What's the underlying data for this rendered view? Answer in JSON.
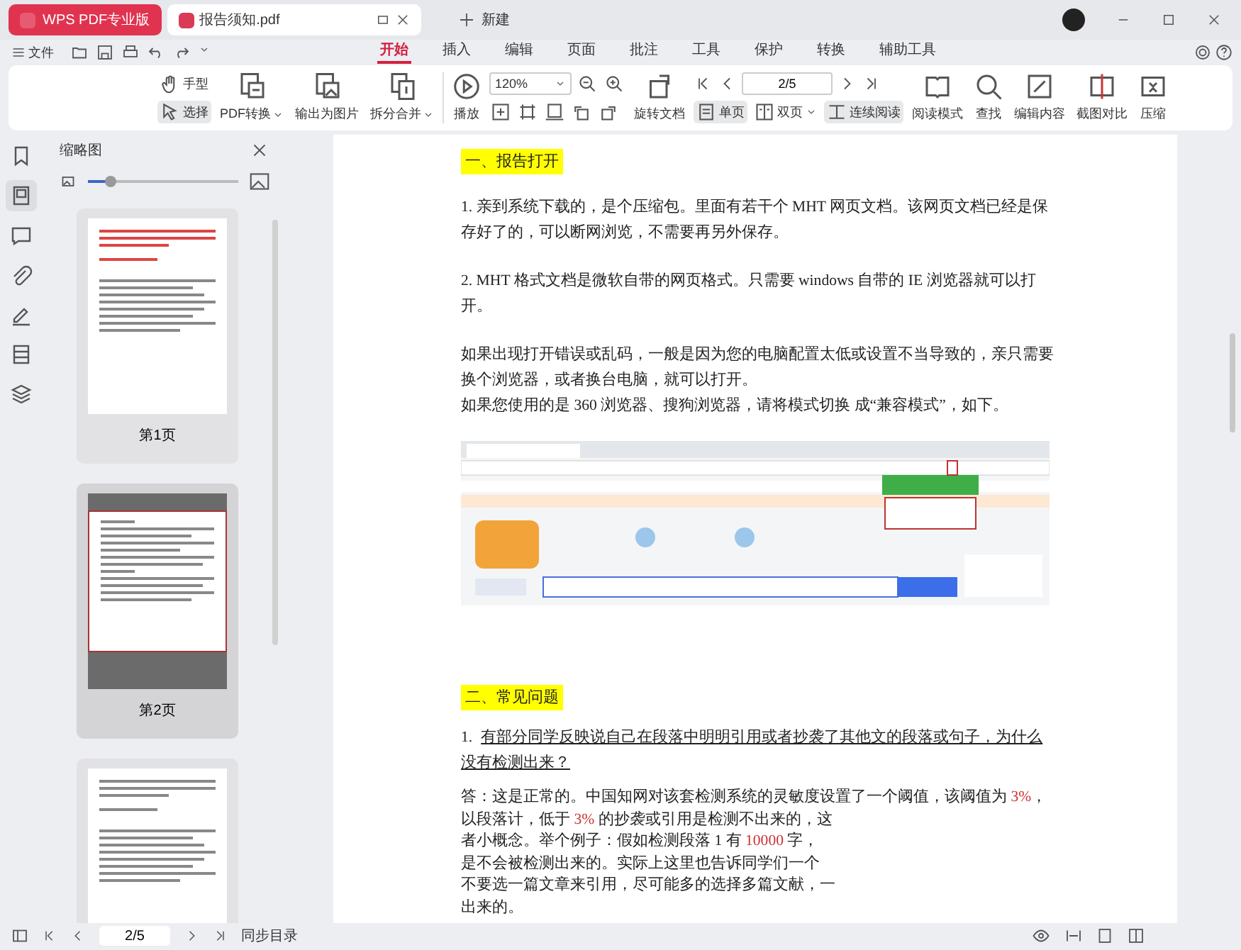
{
  "window": {
    "tabs": [
      {
        "label": "WPS PDF专业版",
        "kind": "brand",
        "selected": false
      },
      {
        "label": "报告须知.pdf",
        "kind": "file",
        "selected": true
      }
    ],
    "new_tab": "新建"
  },
  "menu": {
    "file": "文件",
    "items": [
      {
        "label": "开始",
        "selected": true
      },
      {
        "label": "插入",
        "selected": false
      },
      {
        "label": "编辑",
        "selected": false
      },
      {
        "label": "页面",
        "selected": false
      },
      {
        "label": "批注",
        "selected": false
      },
      {
        "label": "工具",
        "selected": false
      },
      {
        "label": "保护",
        "selected": false
      },
      {
        "label": "转换",
        "selected": false
      },
      {
        "label": "辅助工具",
        "selected": false
      }
    ]
  },
  "ribbon": [
    {
      "kind": "stack",
      "upper": [
        {
          "kind": "tool",
          "label": "手型",
          "selected": false
        }
      ],
      "lower": [
        {
          "kind": "tool",
          "label": "选择",
          "selected": true
        }
      ]
    },
    {
      "kind": "big",
      "label": "PDF转换",
      "dropdown": true
    },
    {
      "kind": "big",
      "label": "输出为图片"
    },
    {
      "kind": "big",
      "label": "拆分合并",
      "dropdown": true
    },
    {
      "kind": "sep"
    },
    {
      "kind": "big",
      "label": "播放"
    },
    {
      "kind": "stack",
      "upper": [
        {
          "kind": "combo",
          "value": "120%"
        },
        {
          "kind": "icon"
        },
        {
          "kind": "icon"
        }
      ],
      "lower": [
        {
          "kind": "icon"
        },
        {
          "kind": "icon"
        },
        {
          "kind": "icon"
        },
        {
          "kind": "icon"
        },
        {
          "kind": "icon"
        }
      ]
    },
    {
      "kind": "big",
      "label": "旋转文档"
    },
    {
      "kind": "stack",
      "upper": [
        {
          "kind": "icon"
        },
        {
          "kind": "icon"
        },
        {
          "kind": "pager",
          "value": "2/5"
        },
        {
          "kind": "icon"
        },
        {
          "kind": "icon"
        }
      ],
      "lower": [
        {
          "kind": "tool",
          "label": "单页",
          "selected": true
        },
        {
          "kind": "tool",
          "label": "双页",
          "selected": false,
          "dropdown": true
        },
        {
          "kind": "tool",
          "label": "连续阅读",
          "selected": true
        }
      ]
    },
    {
      "kind": "big",
      "label": "阅读模式"
    },
    {
      "kind": "big",
      "label": "查找"
    },
    {
      "kind": "big",
      "label": "编辑内容"
    },
    {
      "kind": "big",
      "label": "截图对比"
    },
    {
      "kind": "big",
      "label": "压缩"
    }
  ],
  "sidebar": {
    "items": [
      {
        "kind": "bookmark",
        "selected": false
      },
      {
        "kind": "thumbnails",
        "selected": true
      },
      {
        "kind": "comment",
        "selected": false
      },
      {
        "kind": "attachment",
        "selected": false
      },
      {
        "kind": "signature",
        "selected": false
      },
      {
        "kind": "layout",
        "selected": false
      },
      {
        "kind": "layers",
        "selected": false
      }
    ]
  },
  "thumbnails": {
    "title": "缩略图",
    "size": {
      "level": 0.15
    },
    "pages": [
      {
        "label": "第1页",
        "selected": false
      },
      {
        "label": "第2页",
        "selected": true
      },
      {
        "selected": false
      }
    ]
  },
  "document": {
    "blocks": [
      {
        "kind": "heading",
        "text": "一、报告打开"
      },
      {
        "kind": "para",
        "text": "1. 亲到系统下载的，是个压缩包。里面有若干个 MHT 网页文档。该网页文档已经是保存好了的，可以断网浏览，不需要再另外保存。"
      },
      {
        "kind": "para",
        "text": "2. MHT 格式文档是微软自带的网页格式。只需要 windows 自带的 IE 浏览器就可以打开。"
      },
      {
        "kind": "para",
        "text": "如果出现打开错误或乱码，一般是因为您的电脑配置太低或设置不当导致的，亲只需要换个浏览器，或者换台电脑，就可以打开。"
      },
      {
        "kind": "para-cont",
        "text": "如果您使用的是 360 浏览器、搜狗浏览器，请将模式切换 成“兼容模式”，如下。"
      },
      {
        "kind": "figure"
      },
      {
        "kind": "heading",
        "text": "二、常见问题"
      },
      {
        "kind": "question",
        "number": "1.",
        "text": "有部分同学反映说自己在段落中明明引用或者抄袭了其他文的段落或句子，为什么没有检测出来？"
      },
      {
        "kind": "answer",
        "lines": [
          [
            {
              "kind": "plain",
              "text": "答：这是正常的。中国知网对该套检测系统的灵敏度设置了一个阈值，该阈值为 "
            },
            {
              "kind": "number",
              "text": "3%"
            },
            {
              "kind": "plain",
              "text": "，"
            }
          ],
          [
            {
              "kind": "plain",
              "text": "以段落计，低于 "
            },
            {
              "kind": "number",
              "text": "3%"
            },
            {
              "kind": "plain",
              "text": " 的抄袭或引用是检测不出来的，这"
            }
          ],
          [
            {
              "kind": "plain",
              "text": "者小概念。举个例子：假如检测段落 1 有 "
            },
            {
              "kind": "number",
              "text": "10000"
            },
            {
              "kind": "plain",
              "text": " 字，"
            }
          ],
          [
            {
              "kind": "plain",
              "text": "是不会被检测出来的。实际上这里也告诉同学们一个"
            }
          ],
          [
            {
              "kind": "plain",
              "text": "不要选一篇文章来引用，尽可能多的选择多篇文献，一"
            }
          ],
          [
            {
              "kind": "plain",
              "text": "出来的。"
            }
          ]
        ]
      }
    ]
  },
  "status_bar": {
    "page": "2/5",
    "sync": "同步目录"
  }
}
